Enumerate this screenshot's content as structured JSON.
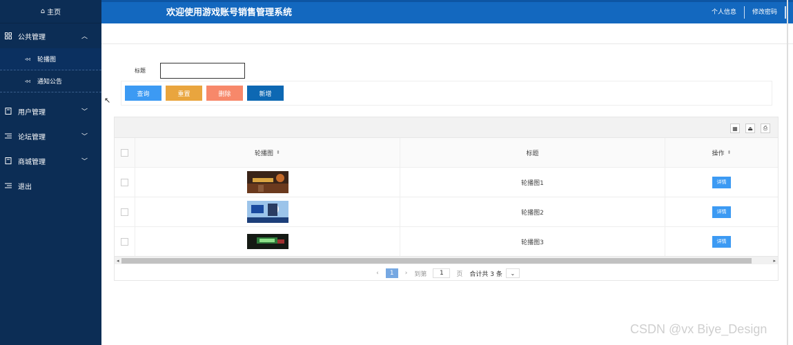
{
  "sidebar": {
    "home": "主页",
    "groups": [
      {
        "label": "公共管理",
        "icon": "grid-icon",
        "chevron": "^"
      },
      {
        "label": "用户管理",
        "icon": "book-icon",
        "chevron": "v"
      },
      {
        "label": "论坛管理",
        "icon": "list-icon",
        "chevron": "v"
      },
      {
        "label": "商城管理",
        "icon": "book-icon",
        "chevron": "v"
      },
      {
        "label": "退出",
        "icon": "list-icon"
      }
    ],
    "sub_items": [
      {
        "label": "轮播图",
        "active": true
      },
      {
        "label": "通知公告",
        "active": false
      }
    ]
  },
  "header": {
    "title": "欢迎使用游戏账号销售管理系统",
    "links": [
      "个人信息",
      "修改密码"
    ]
  },
  "search": {
    "label": "标题",
    "value": "",
    "buttons": [
      "查询",
      "重置",
      "删除",
      "新增"
    ]
  },
  "table": {
    "columns": [
      "轮播图",
      "标题",
      "操作"
    ],
    "rows": [
      {
        "title": "轮播图1",
        "action": "详情"
      },
      {
        "title": "轮播图2",
        "action": "详情"
      },
      {
        "title": "轮播图3",
        "action": "详情"
      }
    ]
  },
  "pagination": {
    "current_page": "1",
    "goto_label": "到第",
    "goto_value": "1",
    "page_unit": "页",
    "total_text": "合计共 3 条"
  },
  "watermark": "CSDN @vx  Biye_Design",
  "colors": {
    "sidebar": "#0c2d55",
    "header": "#1368bf",
    "query": "#3c9af3",
    "reset": "#e9a53e",
    "delete": "#f7886a",
    "add": "#0d68b3"
  }
}
